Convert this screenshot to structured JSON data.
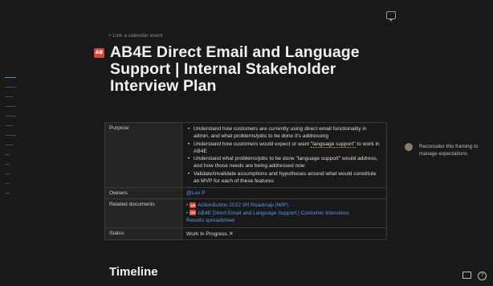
{
  "outline_items": 13,
  "calendar_link": "+ Link a calendar event",
  "title_badge": "AB",
  "title": "AB4E Direct Email and Language Support | Internal Stakeholder Interview Plan",
  "props": {
    "purpose_key": "Purpose",
    "purpose_items": [
      "Understand how customers are currently using direct email functionality in admin, and what problems/jobs to be done it's addressing",
      "Understand how customers would expect or want",
      "Understand what problems/jobs to be done \"language support\" would address, and how those needs are being addressed now",
      "Validate/invalidate assumptions and hypotheses around what would constitute an MVP for each of these features"
    ],
    "purpose_item2_link": "\"language support\"",
    "purpose_item2_tail": " to work in AB4E",
    "owners_key": "Owners",
    "owners_value": "@Lex P",
    "related_key": "Related documents",
    "related_docs": [
      "ActionButton 2022 2H Roadmap (WIP)",
      "AB4E Direct Email and Language Support | Customer Interviews"
    ],
    "related_results": "Results spreadsheet",
    "status_key": "Status",
    "status_value": "Work In Progress"
  },
  "side_comment": "Reconsider this framing to manage expectations",
  "timeline_heading": "Timeline",
  "icons": {
    "comment": "comment-icon",
    "tools": "tools-icon",
    "keyboard": "keyboard-icon",
    "help": "help-icon"
  },
  "colors": {
    "background": "#191919",
    "accent_link": "#5b9ae8",
    "badge_red": "#e0443b"
  }
}
